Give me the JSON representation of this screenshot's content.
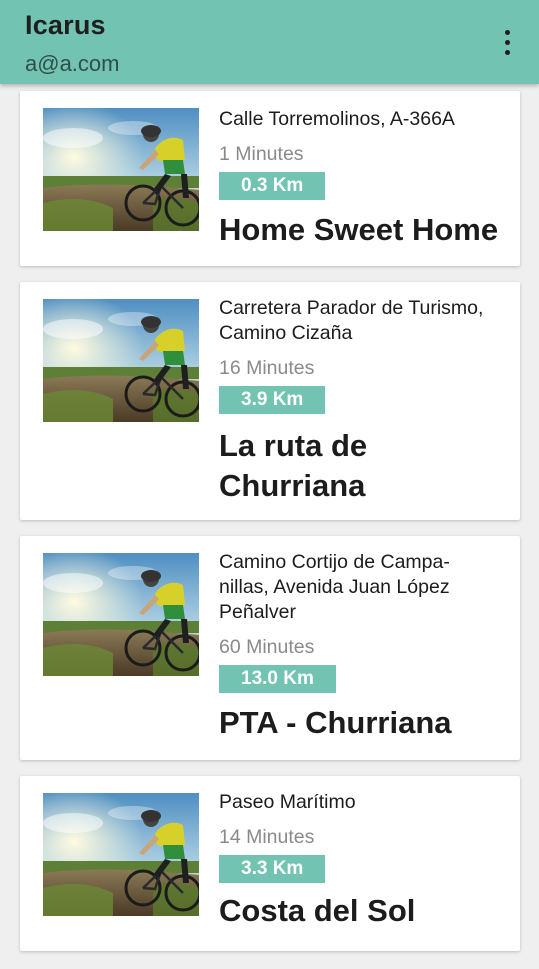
{
  "app": {
    "title": "Icarus",
    "subtitle": "a@a.com",
    "menu_icon": "more-vert-icon"
  },
  "colors": {
    "accent": "#72c3b2",
    "background": "#efefef",
    "card": "#ffffff"
  },
  "routes": [
    {
      "address_lines": [
        "Calle Torremolinos, A-366A"
      ],
      "duration": "1 Minutes",
      "distance": "0.3 Km",
      "name": "Home Sweet Home",
      "image": "cyclist-photo"
    },
    {
      "address_lines": [
        "Carretera Parador de Turismo,",
        "Camino Cizaña"
      ],
      "duration": "16 Minutes",
      "distance": "3.9 Km",
      "name": "La ruta de Churriana",
      "image": "cyclist-photo"
    },
    {
      "address_lines": [
        "Camino Cortijo de Campa-",
        "nillas, Avenida Juan López",
        "Peñalver"
      ],
      "duration": "60 Minutes",
      "distance": "13.0 Km",
      "name": "PTA - Churriana",
      "image": "cyclist-photo"
    },
    {
      "address_lines": [
        "Paseo Marítimo"
      ],
      "duration": "14 Minutes",
      "distance": "3.3 Km",
      "name": "Costa del Sol",
      "image": "cyclist-photo"
    }
  ]
}
